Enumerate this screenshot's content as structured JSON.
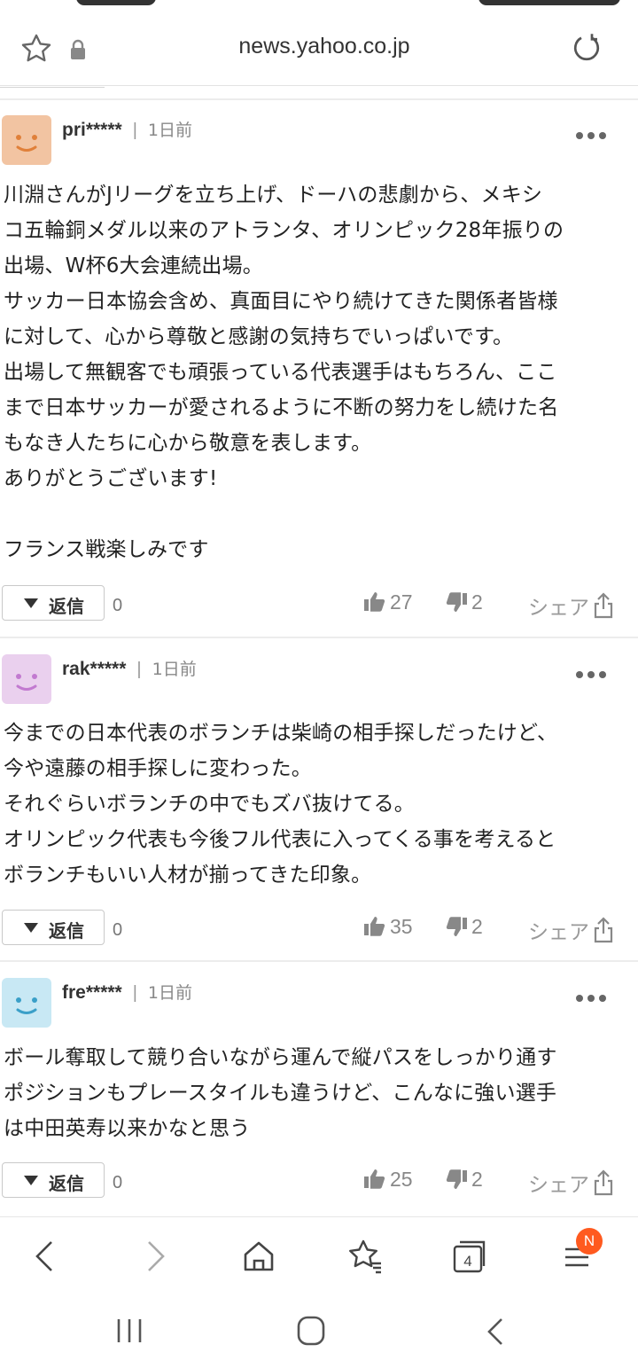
{
  "browser": {
    "url": "news.yahoo.co.jp"
  },
  "comments": [
    {
      "user": "pri*****",
      "time": "1日前",
      "avatar_color": "#f2c4a2",
      "face_color": "#e0803a",
      "text": "川淵さんがJリーグを立ち上げ、ドーハの悲劇から、メキシ\nコ五輪銅メダル以来のアトランタ、オリンピック28年振りの\n出場、W杯6大会連続出場。\nサッカー日本協会含め、真面目にやり続けてきた関係者皆様\nに対して、心から尊敬と感謝の気持ちでいっぱいです。\n出場して無観客でも頑張っている代表選手はもちろん、ここ\nまで日本サッカーが愛されるように不断の努力をし続けた名\nもなき人たちに心から敬意を表します。\nありがとうございます!\n\nフランス戦楽しみです",
      "reply_label": "返信",
      "reply_count": "0",
      "likes": "27",
      "dislikes": "2",
      "share_label": "シェア"
    },
    {
      "user": "rak*****",
      "time": "1日前",
      "avatar_color": "#ead0ee",
      "face_color": "#c27ad0",
      "text": "今までの日本代表のボランチは柴崎の相手探しだったけど、\n今や遠藤の相手探しに変わった。\nそれぐらいボランチの中でもズバ抜けてる。\nオリンピック代表も今後フル代表に入ってくる事を考えると\nボランチもいい人材が揃ってきた印象。",
      "reply_label": "返信",
      "reply_count": "0",
      "likes": "35",
      "dislikes": "2",
      "share_label": "シェア"
    },
    {
      "user": "fre*****",
      "time": "1日前",
      "avatar_color": "#c8e8f4",
      "face_color": "#3a9fc8",
      "text": "ボール奪取して競り合いながら運んで縦パスをしっかり通す\nポジションもプレースタイルも違うけど、こんなに強い選手\nは中田英寿以来かなと思う",
      "reply_label": "返信",
      "reply_count": "0",
      "likes": "25",
      "dislikes": "2",
      "share_label": "シェア"
    }
  ],
  "bottom_nav": {
    "tab_count": "4",
    "menu_badge": "N"
  }
}
